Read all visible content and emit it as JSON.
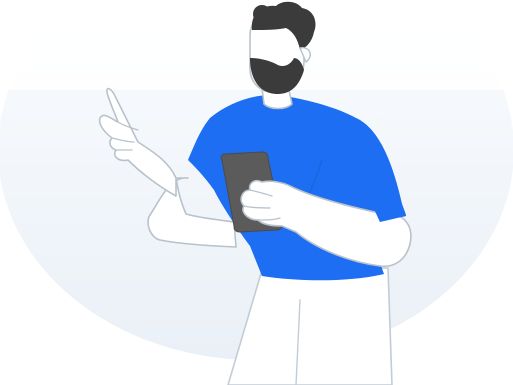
{
  "illustration": {
    "subject": "man-holding-phone-pointing-icon",
    "colors": {
      "shirt": "#1d6ef2",
      "phone": "#5b5b5b",
      "hair": "#3b3b3b",
      "skin": "#ffffff",
      "outline": "#b8c2cc",
      "background": "#f1f5fa"
    }
  }
}
